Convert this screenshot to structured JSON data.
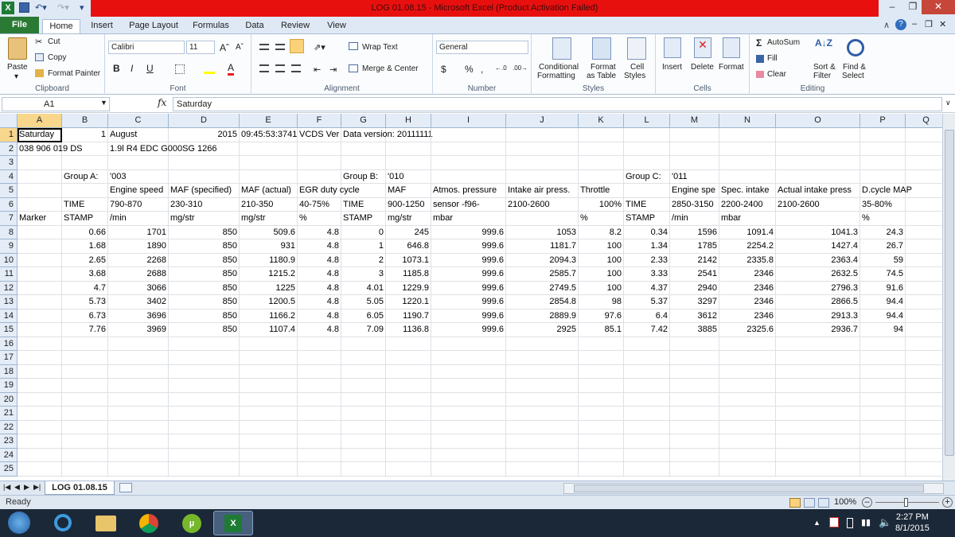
{
  "window": {
    "title": "LOG 01.08.15  -  Microsoft Excel (Product Activation Failed)"
  },
  "ribbon_tabs": [
    "File",
    "Home",
    "Insert",
    "Page Layout",
    "Formulas",
    "Data",
    "Review",
    "View"
  ],
  "ribbon": {
    "clipboard": {
      "paste": "Paste",
      "cut": "Cut",
      "copy": "Copy",
      "format_painter": "Format Painter",
      "label": "Clipboard"
    },
    "font": {
      "name": "Calibri",
      "size": "11",
      "label": "Font",
      "bold": "B",
      "italic": "I",
      "underline": "U"
    },
    "alignment": {
      "wrap_text": "Wrap Text",
      "merge_center": "Merge & Center",
      "label": "Alignment"
    },
    "number": {
      "format": "General",
      "label": "Number",
      "currency": "$",
      "percent": "%",
      "comma": ","
    },
    "styles": {
      "conditional": "Conditional",
      "conditional2": "Formatting",
      "format_as": "Format",
      "format_as2": "as Table",
      "cell": "Cell",
      "cell2": "Styles",
      "label": "Styles"
    },
    "cells": {
      "insert": "Insert",
      "delete": "Delete",
      "format": "Format",
      "label": "Cells"
    },
    "editing": {
      "autosum": "AutoSum",
      "fill": "Fill",
      "clear": "Clear",
      "sort": "Sort &",
      "sort2": "Filter",
      "find": "Find &",
      "find2": "Select",
      "label": "Editing"
    }
  },
  "formula_bar": {
    "name_box": "A1",
    "fx": "fx",
    "content": "Saturday"
  },
  "sheet": {
    "columns": [
      "A",
      "B",
      "C",
      "D",
      "E",
      "F",
      "G",
      "H",
      "I",
      "J",
      "K",
      "L",
      "M",
      "N",
      "O",
      "P",
      "Q"
    ],
    "rows": [
      [
        "Saturday",
        "1",
        "August",
        "2015",
        "09:45:53:3741",
        "VCDS Ver",
        "Data version: 20111111",
        "",
        "",
        "",
        "",
        "",
        "",
        "",
        "",
        "",
        ""
      ],
      [
        "038 906 019 DS",
        "",
        "1.9l R4 EDC G000SG  1266",
        "",
        "",
        "",
        "",
        "",
        "",
        "",
        "",
        "",
        "",
        "",
        "",
        "",
        ""
      ],
      [
        "",
        "",
        "",
        "",
        "",
        "",
        "",
        "",
        "",
        "",
        "",
        "",
        "",
        "",
        "",
        "",
        ""
      ],
      [
        "",
        "Group A:",
        "'003",
        "",
        "",
        "",
        "Group B:",
        "'010",
        "",
        "",
        "",
        "Group C:",
        "'011",
        "",
        "",
        "",
        ""
      ],
      [
        "",
        "",
        "Engine speed",
        "MAF (specified)",
        "MAF (actual)",
        "EGR duty cycle",
        "",
        "MAF",
        "Atmos. pressure",
        "Intake air press.",
        "Throttle",
        "",
        "Engine spe",
        "Spec. intake",
        "Actual intake press",
        "D.cycle MAP",
        ""
      ],
      [
        "",
        "TIME",
        "790-870",
        "230-310",
        "210-350",
        "40-75%",
        "TIME",
        "900-1250",
        "sensor -f96-",
        "2100-2600",
        "100%",
        "TIME",
        "2850-3150",
        "2200-2400",
        "2100-2600",
        "35-80%",
        ""
      ],
      [
        "Marker",
        "STAMP",
        "/min",
        "mg/str",
        "mg/str",
        "%",
        "STAMP",
        "mg/str",
        "mbar",
        "",
        "%",
        "STAMP",
        "/min",
        "mbar",
        "",
        "%",
        ""
      ],
      [
        "",
        "0.66",
        "1701",
        "850",
        "509.6",
        "4.8",
        "0",
        "245",
        "999.6",
        "1053",
        "8.2",
        "0.34",
        "1596",
        "1091.4",
        "1041.3",
        "24.3",
        ""
      ],
      [
        "",
        "1.68",
        "1890",
        "850",
        "931",
        "4.8",
        "1",
        "646.8",
        "999.6",
        "1181.7",
        "100",
        "1.34",
        "1785",
        "2254.2",
        "1427.4",
        "26.7",
        ""
      ],
      [
        "",
        "2.65",
        "2268",
        "850",
        "1180.9",
        "4.8",
        "2",
        "1073.1",
        "999.6",
        "2094.3",
        "100",
        "2.33",
        "2142",
        "2335.8",
        "2363.4",
        "59",
        ""
      ],
      [
        "",
        "3.68",
        "2688",
        "850",
        "1215.2",
        "4.8",
        "3",
        "1185.8",
        "999.6",
        "2585.7",
        "100",
        "3.33",
        "2541",
        "2346",
        "2632.5",
        "74.5",
        ""
      ],
      [
        "",
        "4.7",
        "3066",
        "850",
        "1225",
        "4.8",
        "4.01",
        "1229.9",
        "999.6",
        "2749.5",
        "100",
        "4.37",
        "2940",
        "2346",
        "2796.3",
        "91.6",
        ""
      ],
      [
        "",
        "5.73",
        "3402",
        "850",
        "1200.5",
        "4.8",
        "5.05",
        "1220.1",
        "999.6",
        "2854.8",
        "98",
        "5.37",
        "3297",
        "2346",
        "2866.5",
        "94.4",
        ""
      ],
      [
        "",
        "6.73",
        "3696",
        "850",
        "1166.2",
        "4.8",
        "6.05",
        "1190.7",
        "999.6",
        "2889.9",
        "97.6",
        "6.4",
        "3612",
        "2346",
        "2913.3",
        "94.4",
        ""
      ],
      [
        "",
        "7.76",
        "3969",
        "850",
        "1107.4",
        "4.8",
        "7.09",
        "1136.8",
        "999.6",
        "2925",
        "85.1",
        "7.42",
        "3885",
        "2325.6",
        "2936.7",
        "94",
        ""
      ]
    ],
    "row_numbers": [
      "1",
      "2",
      "3",
      "4",
      "5",
      "6",
      "7",
      "8",
      "9",
      "10",
      "11",
      "12",
      "13",
      "14",
      "15",
      "16",
      "17",
      "18",
      "19",
      "20",
      "21",
      "22",
      "23",
      "24",
      "25"
    ]
  },
  "sheet_tab": "LOG 01.08.15",
  "status": {
    "ready": "Ready",
    "zoom": "100%"
  },
  "taskbar": {
    "time": "2:27 PM",
    "date": "8/1/2015"
  }
}
